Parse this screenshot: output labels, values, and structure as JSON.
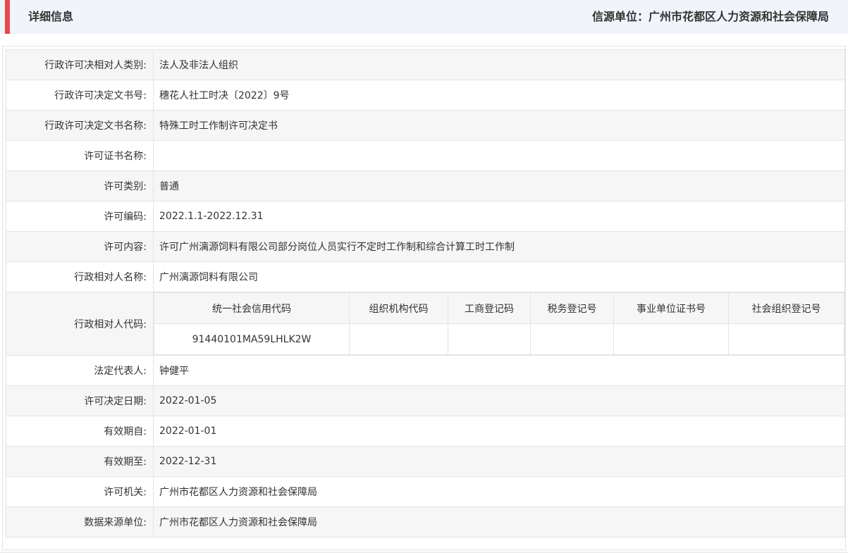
{
  "header": {
    "title": "详细信息",
    "source_label": "信源单位：广州市花都区人力资源和社会保障局"
  },
  "rows_top": [
    {
      "label": "行政许可决相对人类别:",
      "value": "法人及非法人组织"
    },
    {
      "label": "行政许可决定文书号:",
      "value": "穗花人社工时决〔2022〕9号"
    },
    {
      "label": "行政许可决定文书名称:",
      "value": "特殊工时工作制许可决定书"
    },
    {
      "label": "许可证书名称:",
      "value": ""
    },
    {
      "label": "许可类别:",
      "value": "普通"
    },
    {
      "label": "许可编码:",
      "value": "2022.1.1-2022.12.31"
    },
    {
      "label": "许可内容:",
      "value": "许可广州漓源饲料有限公司部分岗位人员实行不定时工作制和综合计算工时工作制"
    },
    {
      "label": "行政相对人名称:",
      "value": "广州漓源饲料有限公司"
    }
  ],
  "code_row": {
    "label": "行政相对人代码:",
    "headers": [
      "统一社会信用代码",
      "组织机构代码",
      "工商登记码",
      "税务登记号",
      "事业单位证书号",
      "社会组织登记号"
    ],
    "values": [
      "91440101MA59LHLK2W",
      "",
      "",
      "",
      "",
      ""
    ]
  },
  "rows_bottom": [
    {
      "label": "法定代表人:",
      "value": "钟健平"
    },
    {
      "label": "许可决定日期:",
      "value": "2022-01-05"
    },
    {
      "label": "有效期自:",
      "value": "2022-01-01"
    },
    {
      "label": "有效期至:",
      "value": "2022-12-31"
    },
    {
      "label": "许可机关:",
      "value": "广州市花都区人力资源和社会保障局"
    },
    {
      "label": "数据来源单位:",
      "value": "广州市花都区人力资源和社会保障局"
    }
  ]
}
